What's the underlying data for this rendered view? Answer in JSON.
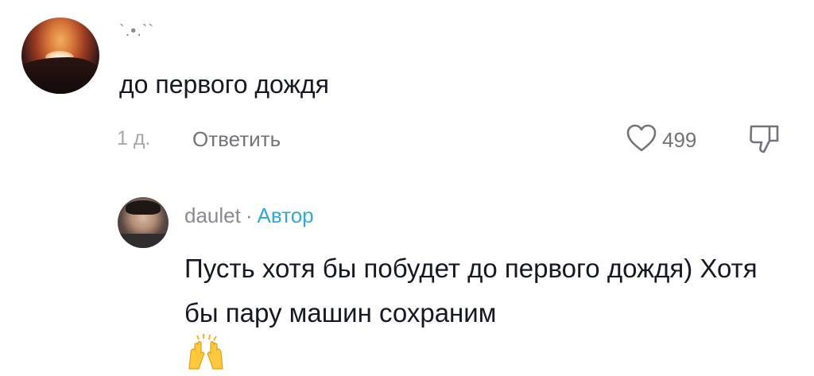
{
  "main_comment": {
    "username": "`.•.``",
    "text": "до первого дождя",
    "time": "1 д.",
    "reply_label": "Ответить",
    "likes": "499"
  },
  "reply_comment": {
    "username": "daulet",
    "separator": "·",
    "author_badge": "Автор",
    "text": "Пусть хотя бы побудет до первого дождя)   Хотя бы пару машин сохраним"
  },
  "icons": {
    "like": "heart-outline-icon",
    "dislike": "thumbs-down-outline-icon",
    "emoji": "raising-hands-emoji"
  },
  "colors": {
    "text": "#161823",
    "muted": "#8a8b91",
    "author_badge": "#2fa9d8"
  }
}
